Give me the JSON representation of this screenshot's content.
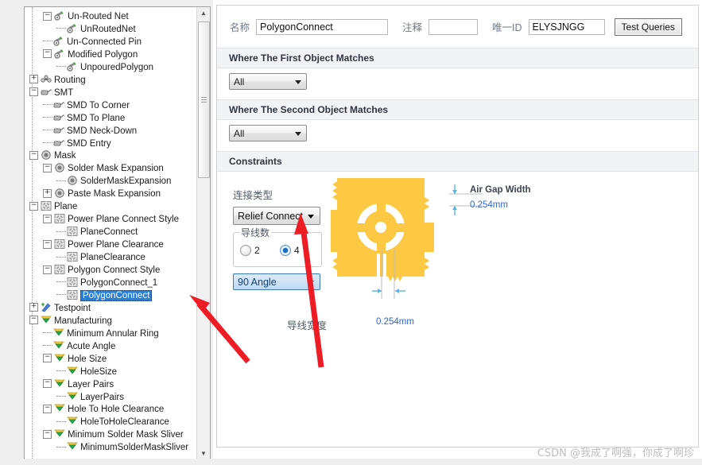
{
  "tree": {
    "items": [
      {
        "label": "Un-Routed Net",
        "depth": 2,
        "toggle": "minus",
        "icon": "net-icon"
      },
      {
        "label": "UnRoutedNet",
        "depth": 3,
        "toggle": "leaf",
        "icon": "net-icon"
      },
      {
        "label": "Un-Connected Pin",
        "depth": 2,
        "toggle": "leaf",
        "icon": "net-icon"
      },
      {
        "label": "Modified Polygon",
        "depth": 2,
        "toggle": "minus",
        "icon": "net-icon"
      },
      {
        "label": "UnpouredPolygon",
        "depth": 3,
        "toggle": "leaf",
        "icon": "net-icon"
      },
      {
        "label": "Routing",
        "depth": 1,
        "toggle": "plus",
        "icon": "routing-icon"
      },
      {
        "label": "SMT",
        "depth": 1,
        "toggle": "minus",
        "icon": "smt-icon"
      },
      {
        "label": "SMD To Corner",
        "depth": 2,
        "toggle": "leaf",
        "icon": "smt-icon"
      },
      {
        "label": "SMD To Plane",
        "depth": 2,
        "toggle": "leaf",
        "icon": "smt-icon"
      },
      {
        "label": "SMD Neck-Down",
        "depth": 2,
        "toggle": "leaf",
        "icon": "smt-icon"
      },
      {
        "label": "SMD Entry",
        "depth": 2,
        "toggle": "leaf",
        "icon": "smt-icon"
      },
      {
        "label": "Mask",
        "depth": 1,
        "toggle": "minus",
        "icon": "mask-icon"
      },
      {
        "label": "Solder Mask Expansion",
        "depth": 2,
        "toggle": "minus",
        "icon": "mask-icon"
      },
      {
        "label": "SolderMaskExpansion",
        "depth": 3,
        "toggle": "leaf",
        "icon": "mask-icon"
      },
      {
        "label": "Paste Mask Expansion",
        "depth": 2,
        "toggle": "plus",
        "icon": "mask-icon"
      },
      {
        "label": "Plane",
        "depth": 1,
        "toggle": "minus",
        "icon": "plane-icon"
      },
      {
        "label": "Power Plane Connect Style",
        "depth": 2,
        "toggle": "minus",
        "icon": "plane-icon"
      },
      {
        "label": "PlaneConnect",
        "depth": 3,
        "toggle": "leaf",
        "icon": "plane-icon"
      },
      {
        "label": "Power Plane Clearance",
        "depth": 2,
        "toggle": "minus",
        "icon": "plane-icon"
      },
      {
        "label": "PlaneClearance",
        "depth": 3,
        "toggle": "leaf",
        "icon": "plane-icon"
      },
      {
        "label": "Polygon Connect Style",
        "depth": 2,
        "toggle": "minus",
        "icon": "plane-icon"
      },
      {
        "label": "PolygonConnect_1",
        "depth": 3,
        "toggle": "leaf",
        "icon": "plane-icon"
      },
      {
        "label": "PolygonConnect",
        "depth": 3,
        "toggle": "leaf",
        "icon": "plane-icon",
        "selected": true
      },
      {
        "label": "Testpoint",
        "depth": 1,
        "toggle": "plus",
        "icon": "testpoint-icon"
      },
      {
        "label": "Manufacturing",
        "depth": 1,
        "toggle": "minus",
        "icon": "manufacturing-icon"
      },
      {
        "label": "Minimum Annular Ring",
        "depth": 2,
        "toggle": "leaf",
        "icon": "manufacturing-icon"
      },
      {
        "label": "Acute Angle",
        "depth": 2,
        "toggle": "leaf",
        "icon": "manufacturing-icon"
      },
      {
        "label": "Hole Size",
        "depth": 2,
        "toggle": "minus",
        "icon": "manufacturing-icon"
      },
      {
        "label": "HoleSize",
        "depth": 3,
        "toggle": "leaf",
        "icon": "manufacturing-icon"
      },
      {
        "label": "Layer Pairs",
        "depth": 2,
        "toggle": "minus",
        "icon": "manufacturing-icon"
      },
      {
        "label": "LayerPairs",
        "depth": 3,
        "toggle": "leaf",
        "icon": "manufacturing-icon"
      },
      {
        "label": "Hole To Hole Clearance",
        "depth": 2,
        "toggle": "minus",
        "icon": "manufacturing-icon"
      },
      {
        "label": "HoleToHoleClearance",
        "depth": 3,
        "toggle": "leaf",
        "icon": "manufacturing-icon"
      },
      {
        "label": "Minimum Solder Mask Sliver",
        "depth": 2,
        "toggle": "minus",
        "icon": "manufacturing-icon"
      },
      {
        "label": "MinimumSolderMaskSliver",
        "depth": 3,
        "toggle": "leaf",
        "icon": "manufacturing-icon"
      }
    ],
    "scroll_up_glyph": "▲",
    "scroll_down_glyph": "▼"
  },
  "header": {
    "name_label": "名称",
    "name_value": "PolygonConnect",
    "comment_label": "注释",
    "comment_value": "",
    "comment_placeholder": "",
    "uid_label": "唯一ID",
    "uid_value": "ELYSJNGG",
    "test_queries_label": "Test Queries"
  },
  "sections": {
    "first_object": "Where The First Object Matches",
    "second_object": "Where The Second Object Matches",
    "constraints": "Constraints",
    "first_object_filter": "All",
    "second_object_filter": "All"
  },
  "constraints": {
    "connect_style_label": "连接类型",
    "connect_style_value": "Relief Connect",
    "conductors_group_label": "导线数",
    "conductor_option_2": "2",
    "conductor_option_4": "4",
    "conductor_selected": "4",
    "angle_value": "90 Angle",
    "conductor_width_label": "导线宽度",
    "conductor_width_value": "0.254mm",
    "air_gap_label": "Air Gap Width",
    "air_gap_value": "0.254mm"
  },
  "colors": {
    "selection_blue": "#2a7fd4",
    "copper": "#fdc843",
    "dim_blue": "#3366cc",
    "arrow_red": "#ee1c25",
    "section_bar": "#f1f3f6"
  },
  "watermark": {
    "text": "CSDN @我成了啊强，你成了啊珍"
  }
}
